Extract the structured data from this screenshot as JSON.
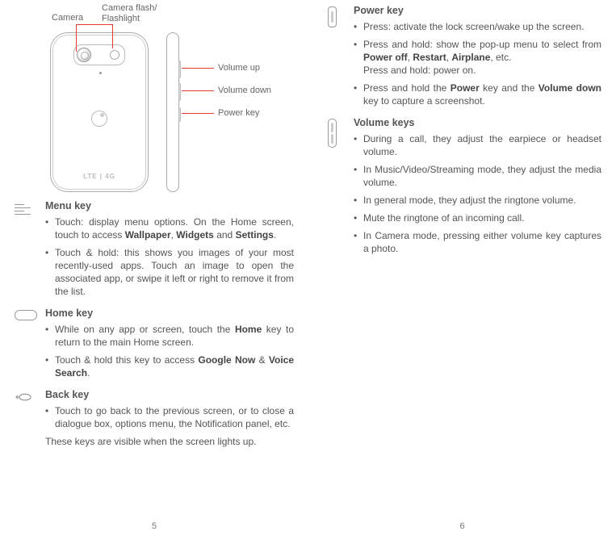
{
  "left": {
    "diagram": {
      "camera": "Camera",
      "flash": "Camera flash/\nFlashlight",
      "volume_up": "Volume up",
      "volume_down": "Volume down",
      "power_key": "Power key",
      "lte": "LTE | 4G"
    },
    "menu": {
      "title": "Menu key",
      "items": [
        "Touch: display menu options. On the Home screen, touch to access <b>Wallpaper</b>, <b>Widgets</b> and <b>Settings</b>.",
        "Touch & hold: this shows you images of your most recently-used apps. Touch an image to open the associated app, or swipe it left or right to remove it from the list."
      ]
    },
    "home": {
      "title": "Home key",
      "items": [
        "While on any app or screen, touch the <b>Home</b> key to return to the main Home screen.",
        "Touch & hold this key to access <b>Google Now</b> & <b>Voice Search</b>."
      ]
    },
    "back": {
      "title": "Back key",
      "items": [
        "Touch to go back to the previous screen, or to close a dialogue box, options menu, the Notification panel, etc."
      ],
      "note": "These keys are visible when the screen lights up."
    },
    "page": "5"
  },
  "right": {
    "power": {
      "title": "Power key",
      "items": [
        "Press: activate the lock screen/wake up the screen.",
        "Press and hold: show the pop-up menu to select from <b>Power off</b>, <b>Restart</b>, <b>Airplane</b>, etc.<br>Press and hold: power on.",
        "Press and hold the <b>Power</b> key and the <b>Volume down</b> key to capture a screenshot."
      ]
    },
    "volume": {
      "title": "Volume keys",
      "items": [
        "During a call, they adjust the earpiece or headset volume.",
        "In Music/Video/Streaming mode, they adjust the media volume.",
        "In general mode, they adjust the ringtone volume.",
        "Mute the ringtone of an incoming call.",
        "In Camera mode, pressing either volume key captures a photo."
      ]
    },
    "page": "6"
  }
}
